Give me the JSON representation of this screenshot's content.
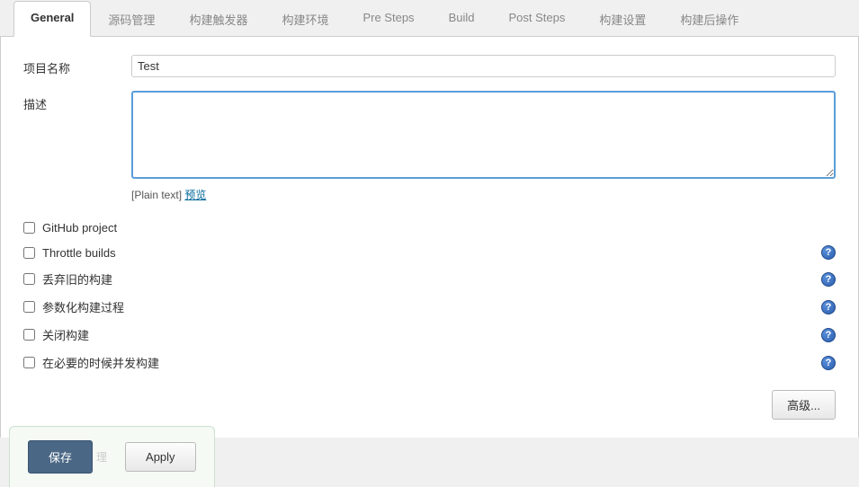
{
  "tabs": [
    {
      "label": "General",
      "active": true
    },
    {
      "label": "源码管理",
      "active": false
    },
    {
      "label": "构建触发器",
      "active": false
    },
    {
      "label": "构建环境",
      "active": false
    },
    {
      "label": "Pre Steps",
      "active": false
    },
    {
      "label": "Build",
      "active": false
    },
    {
      "label": "Post Steps",
      "active": false
    },
    {
      "label": "构建设置",
      "active": false
    },
    {
      "label": "构建后操作",
      "active": false
    }
  ],
  "form": {
    "name_label": "项目名称",
    "name_value": "Test",
    "desc_label": "描述",
    "desc_value": "",
    "hint_plain": "[Plain text]",
    "hint_preview": "预览"
  },
  "checkboxes": [
    {
      "label": "GitHub project",
      "help": false
    },
    {
      "label": "Throttle builds",
      "help": true
    },
    {
      "label": "丢弃旧的构建",
      "help": true
    },
    {
      "label": "参数化构建过程",
      "help": true
    },
    {
      "label": "关闭构建",
      "help": true
    },
    {
      "label": "在必要的时候并发构建",
      "help": true
    }
  ],
  "buttons": {
    "advanced": "高级...",
    "save": "保存",
    "apply": "Apply",
    "ghost": "理"
  }
}
